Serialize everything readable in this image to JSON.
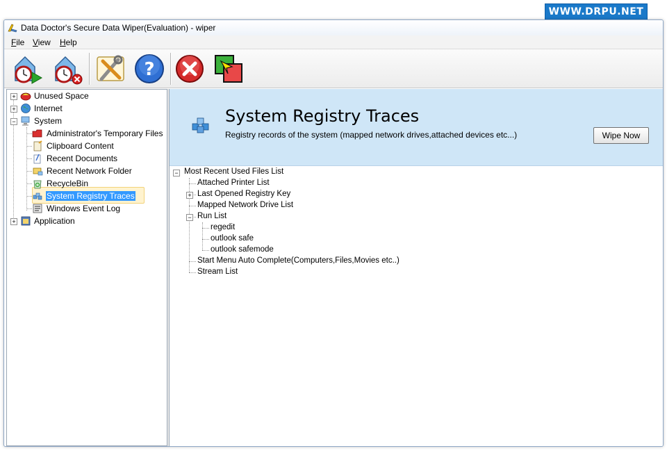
{
  "watermark": "WWW.DRPU.NET",
  "window": {
    "title": "Data Doctor's Secure Data Wiper(Evaluation) - wiper"
  },
  "menu": [
    {
      "pre": "",
      "u": "F",
      "post": "ile"
    },
    {
      "pre": "",
      "u": "V",
      "post": "iew"
    },
    {
      "pre": "",
      "u": "H",
      "post": "elp"
    }
  ],
  "toolbar": {
    "buttons": [
      "schedule-wipe-icon",
      "cancel-schedule-icon",
      "settings-icon",
      "help-icon",
      "exit-icon",
      "switch-view-icon"
    ]
  },
  "left_tree": {
    "unused_space": "Unused Space",
    "internet": "Internet",
    "system": "System",
    "system_children": [
      "Administrator's Temporary Files",
      "Clipboard Content",
      "Recent Documents",
      "Recent Network Folder",
      "RecycleBin",
      "System Registry Traces",
      "Windows Event Log"
    ],
    "application": "Application",
    "selected": "System Registry Traces"
  },
  "header": {
    "title": "System Registry Traces",
    "subtitle": "Registry records of the system (mapped network drives,attached devices etc...)",
    "button": "Wipe Now"
  },
  "right_tree": {
    "root": "Most Recent Used Files List",
    "children": [
      "Attached Printer List",
      "Last Opened Registry Key",
      "Mapped Network Drive List",
      "Run List",
      "Start Menu Auto Complete(Computers,Files,Movies etc..)",
      "Stream List"
    ],
    "run_list_children": [
      "regedit",
      "outlook safe",
      "outlook safemode"
    ]
  }
}
